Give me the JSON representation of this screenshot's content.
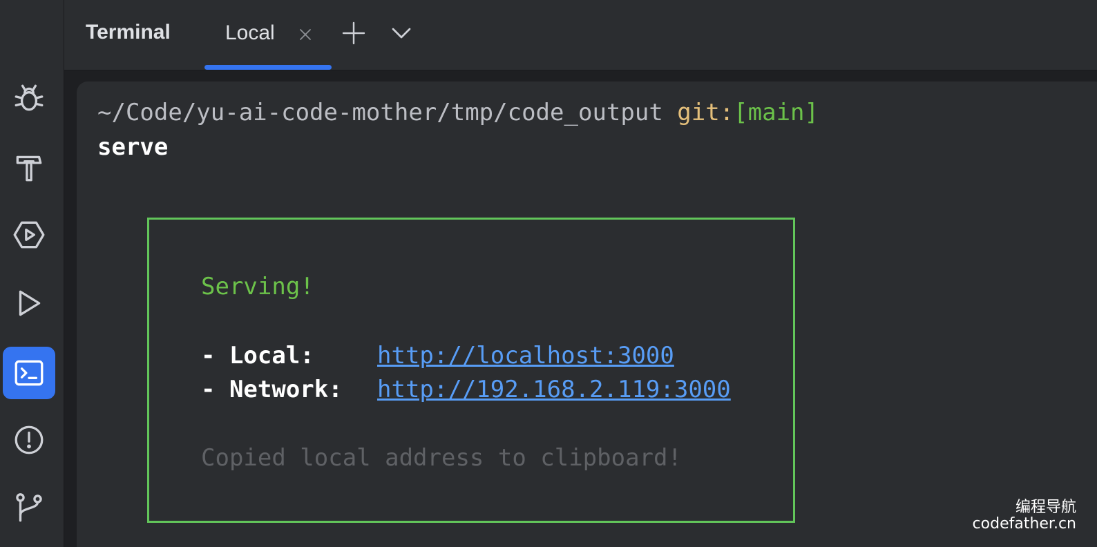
{
  "header": {
    "title": "Terminal",
    "tab_label": "Local"
  },
  "toolstrip": {
    "icons": [
      "bug-icon",
      "hammer-icon",
      "services-icon",
      "run-icon",
      "terminal-icon",
      "problems-icon",
      "git-icon"
    ],
    "active": "terminal-icon"
  },
  "terminal": {
    "prompt_path": "~/Code/yu-ai-code-mother/tmp/code_output",
    "prompt_git_label": "git:",
    "prompt_branch": "[main]",
    "command": "serve",
    "serving_text": "Serving!",
    "local_label": "- Local:",
    "local_url": "http://localhost:3000",
    "network_label": "- Network:",
    "network_url": "http://192.168.2.119:3000",
    "copied_text": "Copied local address to clipboard!"
  },
  "watermark": {
    "line1": "编程导航",
    "line2": "codefather.cn"
  },
  "colors": {
    "accent": "#3574f0",
    "box_border": "#62c55a",
    "link": "#589df6",
    "git_label": "#e5c07b",
    "branch": "#6cc24a"
  }
}
